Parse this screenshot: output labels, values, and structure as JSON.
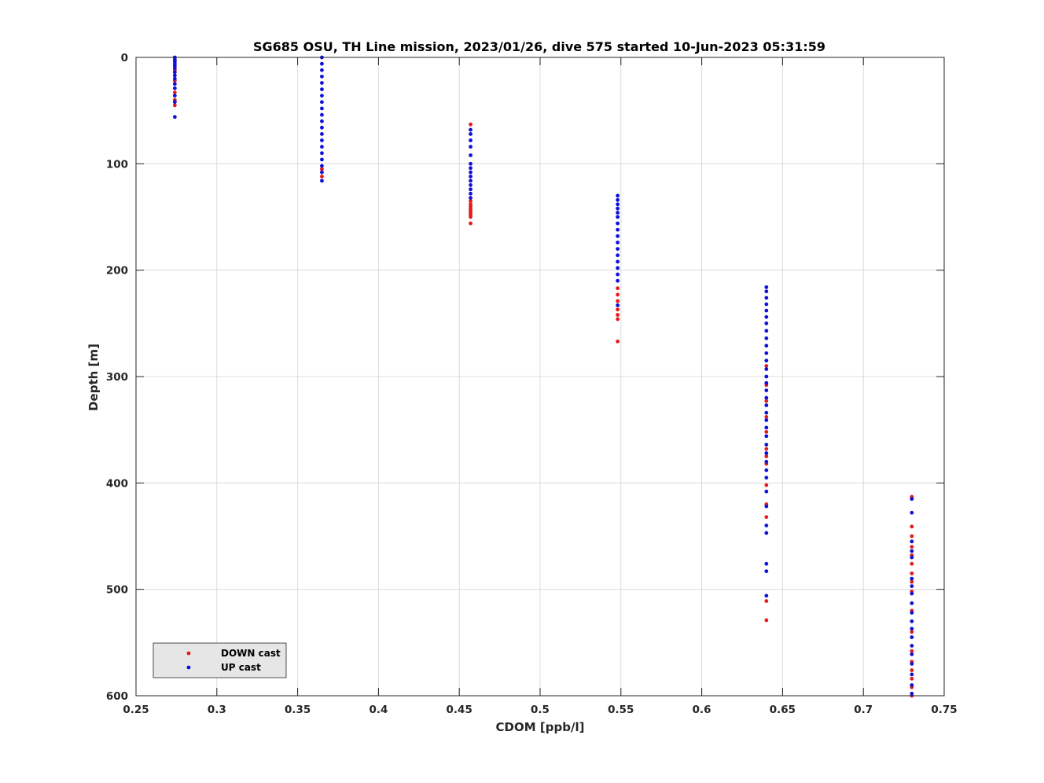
{
  "colors": {
    "down": "#e41a1c",
    "up": "#1010d8",
    "grid": "#dcdcdc",
    "axis": "#262626",
    "legend_bg": "#e6e6e6"
  },
  "chart_data": {
    "type": "scatter",
    "title": "SG685 OSU, TH Line mission, 2023/01/26, dive 575 started 10-Jun-2023 05:31:59",
    "xlabel": "CDOM [ppb/l]",
    "ylabel": "Depth [m]",
    "xlim": [
      0.25,
      0.75
    ],
    "ylim": [
      0,
      600
    ],
    "y_reversed": true,
    "grid": true,
    "legend_placement": "bottom-left",
    "xticks": [
      "0.25",
      "0.3",
      "0.35",
      "0.4",
      "0.45",
      "0.5",
      "0.55",
      "0.6",
      "0.65",
      "0.7",
      "0.75"
    ],
    "yticks": [
      "0",
      "100",
      "200",
      "300",
      "400",
      "500",
      "600"
    ],
    "series": [
      {
        "name": "DOWN cast",
        "color_key": "down",
        "points": [
          [
            0.274,
            3
          ],
          [
            0.274,
            12
          ],
          [
            0.274,
            22
          ],
          [
            0.274,
            33
          ],
          [
            0.274,
            40
          ],
          [
            0.274,
            45
          ],
          [
            0.365,
            105
          ],
          [
            0.365,
            112
          ],
          [
            0.457,
            63
          ],
          [
            0.457,
            135
          ],
          [
            0.457,
            138
          ],
          [
            0.457,
            140
          ],
          [
            0.457,
            142
          ],
          [
            0.457,
            144
          ],
          [
            0.457,
            146
          ],
          [
            0.457,
            148
          ],
          [
            0.457,
            150
          ],
          [
            0.457,
            156
          ],
          [
            0.548,
            217
          ],
          [
            0.548,
            223
          ],
          [
            0.548,
            229
          ],
          [
            0.548,
            237
          ],
          [
            0.548,
            242
          ],
          [
            0.548,
            246
          ],
          [
            0.548,
            267
          ],
          [
            0.64,
            290
          ],
          [
            0.64,
            308
          ],
          [
            0.64,
            323
          ],
          [
            0.64,
            338
          ],
          [
            0.64,
            352
          ],
          [
            0.64,
            368
          ],
          [
            0.64,
            375
          ],
          [
            0.64,
            382
          ],
          [
            0.64,
            402
          ],
          [
            0.64,
            420
          ],
          [
            0.64,
            432
          ],
          [
            0.64,
            511
          ],
          [
            0.64,
            529
          ],
          [
            0.73,
            413
          ],
          [
            0.73,
            441
          ],
          [
            0.73,
            450
          ],
          [
            0.73,
            460
          ],
          [
            0.73,
            468
          ],
          [
            0.73,
            476
          ],
          [
            0.73,
            485
          ],
          [
            0.73,
            493
          ],
          [
            0.73,
            502
          ],
          [
            0.73,
            520
          ],
          [
            0.73,
            540
          ],
          [
            0.73,
            558
          ],
          [
            0.73,
            568
          ],
          [
            0.73,
            576
          ],
          [
            0.73,
            584
          ],
          [
            0.73,
            592
          ],
          [
            0.73,
            600
          ]
        ]
      },
      {
        "name": "UP cast",
        "color_key": "up",
        "points": [
          [
            0.274,
            0
          ],
          [
            0.274,
            2
          ],
          [
            0.274,
            4
          ],
          [
            0.274,
            6
          ],
          [
            0.274,
            8
          ],
          [
            0.274,
            10
          ],
          [
            0.274,
            14
          ],
          [
            0.274,
            17
          ],
          [
            0.274,
            20
          ],
          [
            0.274,
            25
          ],
          [
            0.274,
            29
          ],
          [
            0.274,
            36
          ],
          [
            0.274,
            42
          ],
          [
            0.274,
            56
          ],
          [
            0.365,
            0
          ],
          [
            0.365,
            6
          ],
          [
            0.365,
            12
          ],
          [
            0.365,
            18
          ],
          [
            0.365,
            24
          ],
          [
            0.365,
            30
          ],
          [
            0.365,
            36
          ],
          [
            0.365,
            42
          ],
          [
            0.365,
            48
          ],
          [
            0.365,
            54
          ],
          [
            0.365,
            60
          ],
          [
            0.365,
            66
          ],
          [
            0.365,
            72
          ],
          [
            0.365,
            78
          ],
          [
            0.365,
            84
          ],
          [
            0.365,
            90
          ],
          [
            0.365,
            96
          ],
          [
            0.365,
            102
          ],
          [
            0.365,
            108
          ],
          [
            0.365,
            116
          ],
          [
            0.457,
            68
          ],
          [
            0.457,
            72
          ],
          [
            0.457,
            78
          ],
          [
            0.457,
            84
          ],
          [
            0.457,
            92
          ],
          [
            0.457,
            100
          ],
          [
            0.457,
            104
          ],
          [
            0.457,
            108
          ],
          [
            0.457,
            112
          ],
          [
            0.457,
            116
          ],
          [
            0.457,
            120
          ],
          [
            0.457,
            124
          ],
          [
            0.457,
            128
          ],
          [
            0.457,
            132
          ],
          [
            0.548,
            130
          ],
          [
            0.548,
            134
          ],
          [
            0.548,
            138
          ],
          [
            0.548,
            142
          ],
          [
            0.548,
            146
          ],
          [
            0.548,
            150
          ],
          [
            0.548,
            156
          ],
          [
            0.548,
            162
          ],
          [
            0.548,
            168
          ],
          [
            0.548,
            174
          ],
          [
            0.548,
            180
          ],
          [
            0.548,
            186
          ],
          [
            0.548,
            192
          ],
          [
            0.548,
            198
          ],
          [
            0.548,
            204
          ],
          [
            0.548,
            210
          ],
          [
            0.548,
            233
          ],
          [
            0.64,
            216
          ],
          [
            0.64,
            220
          ],
          [
            0.64,
            226
          ],
          [
            0.64,
            232
          ],
          [
            0.64,
            238
          ],
          [
            0.64,
            244
          ],
          [
            0.64,
            250
          ],
          [
            0.64,
            257
          ],
          [
            0.64,
            264
          ],
          [
            0.64,
            271
          ],
          [
            0.64,
            278
          ],
          [
            0.64,
            285
          ],
          [
            0.64,
            293
          ],
          [
            0.64,
            300
          ],
          [
            0.64,
            306
          ],
          [
            0.64,
            313
          ],
          [
            0.64,
            320
          ],
          [
            0.64,
            327
          ],
          [
            0.64,
            334
          ],
          [
            0.64,
            341
          ],
          [
            0.64,
            348
          ],
          [
            0.64,
            356
          ],
          [
            0.64,
            364
          ],
          [
            0.64,
            372
          ],
          [
            0.64,
            380
          ],
          [
            0.64,
            388
          ],
          [
            0.64,
            395
          ],
          [
            0.64,
            408
          ],
          [
            0.64,
            422
          ],
          [
            0.64,
            440
          ],
          [
            0.64,
            447
          ],
          [
            0.64,
            476
          ],
          [
            0.64,
            483
          ],
          [
            0.64,
            506
          ],
          [
            0.73,
            415
          ],
          [
            0.73,
            428
          ],
          [
            0.73,
            455
          ],
          [
            0.73,
            464
          ],
          [
            0.73,
            470
          ],
          [
            0.73,
            490
          ],
          [
            0.73,
            497
          ],
          [
            0.73,
            504
          ],
          [
            0.73,
            513
          ],
          [
            0.73,
            522
          ],
          [
            0.73,
            530
          ],
          [
            0.73,
            537
          ],
          [
            0.73,
            545
          ],
          [
            0.73,
            553
          ],
          [
            0.73,
            561
          ],
          [
            0.73,
            570
          ],
          [
            0.73,
            580
          ],
          [
            0.73,
            590
          ],
          [
            0.73,
            598
          ]
        ]
      }
    ]
  }
}
